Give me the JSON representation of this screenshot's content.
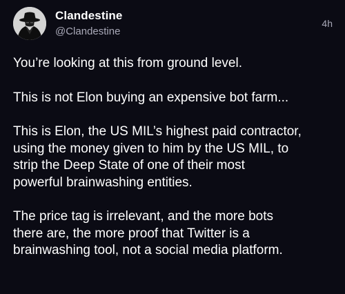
{
  "colors": {
    "background": "#0b0b14",
    "text_primary": "#ffffff",
    "text_secondary": "#a9a9b8"
  },
  "author": {
    "avatar_icon": "hooded-figure-avatar",
    "display_name": "Clandestine",
    "handle": "@Clandestine"
  },
  "post": {
    "timestamp": "4h",
    "paragraphs": [
      "You’re looking at this from ground level.",
      "This is not Elon buying an expensive bot farm...",
      "This is Elon, the US MIL’s highest paid contractor,\nusing the money given to him by the US MIL, to\nstrip the Deep State of one of their most\npowerful brainwashing entities.",
      "The price tag is irrelevant, and the more bots\nthere are, the more proof that Twitter is a\nbrainwashing tool, not a social media platform."
    ]
  }
}
